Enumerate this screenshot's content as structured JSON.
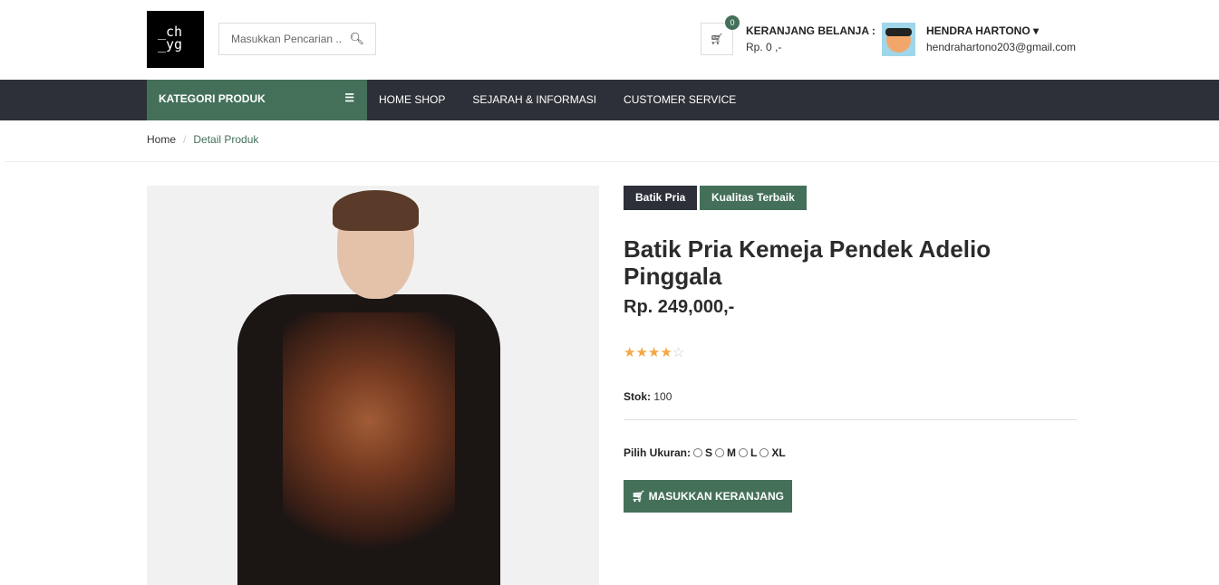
{
  "header": {
    "logo_text": "ych yga",
    "search_placeholder": "Masukkan Pencarian ..",
    "search_icon": "search-icon",
    "cart_count": "0",
    "cart_label": "KERANJANG BELANJA :",
    "cart_total": "Rp. 0 ,-",
    "user_name": "HENDRA HARTONO",
    "user_email": "hendrahartono203@gmail.com"
  },
  "nav": {
    "category_label": "KATEGORI PRODUK",
    "items": [
      {
        "label": "HOME SHOP"
      },
      {
        "label": "SEJARAH & INFORMASI"
      },
      {
        "label": "CUSTOMER SERVICE"
      }
    ]
  },
  "breadcrumb": {
    "home": "Home",
    "sep": "/",
    "current": "Detail Produk"
  },
  "product": {
    "tags": [
      "Batik Pria",
      "Kualitas Terbaik"
    ],
    "title": "Batik Pria Kemeja Pendek Adelio Pinggala",
    "price": "Rp. 249,000,-",
    "rating": 4,
    "rating_max": 5,
    "stock_label": "Stok:",
    "stock_value": "100",
    "size_label": "Pilih Ukuran:",
    "sizes": [
      "S",
      "M",
      "L",
      "XL"
    ],
    "add_to_cart": "MASUKKAN KERANJANG"
  },
  "colors": {
    "accent": "#44705a",
    "nav": "#2d3038",
    "star": "#f5a742"
  }
}
